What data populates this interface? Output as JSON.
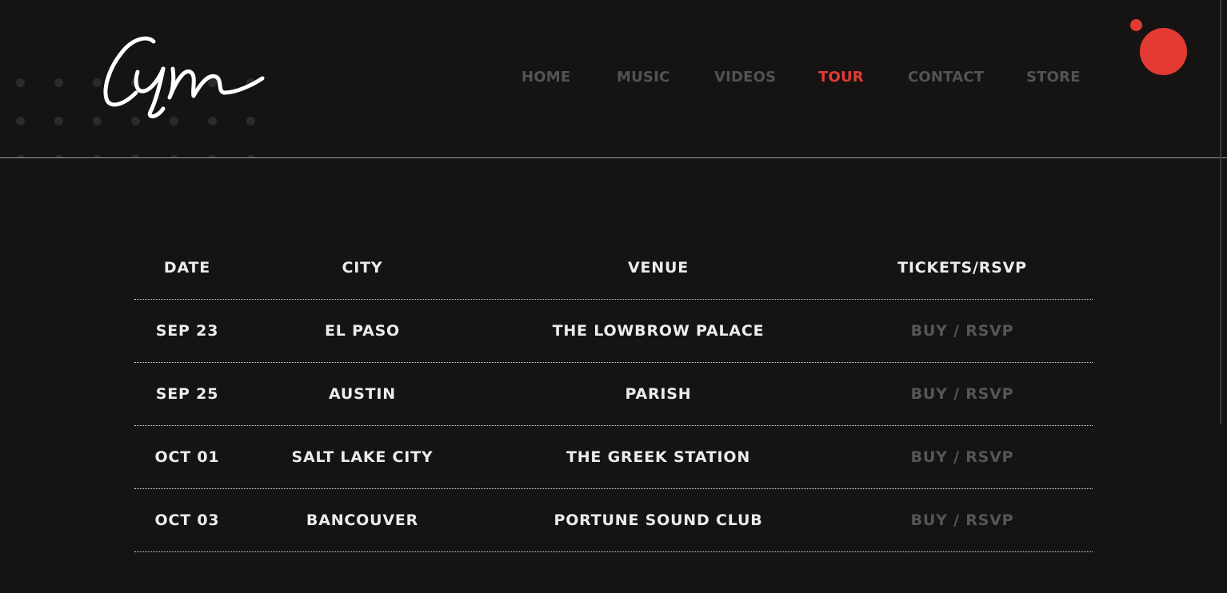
{
  "nav": {
    "items": [
      {
        "label": "HOME",
        "active": false
      },
      {
        "label": "MUSIC",
        "active": false
      },
      {
        "label": "VIDEOS",
        "active": false
      },
      {
        "label": "TOUR",
        "active": true
      },
      {
        "label": "CONTACT",
        "active": false
      },
      {
        "label": "STORE",
        "active": false
      }
    ]
  },
  "colors": {
    "background": "#151413",
    "accent": "#e33a33",
    "nav_inactive": "#555352",
    "text": "#ececea",
    "link_muted": "#585655"
  },
  "tour": {
    "headers": {
      "date": "DATE",
      "city": "CITY",
      "venue": "VENUE",
      "tickets": "TICKETS/RSVP"
    },
    "rows": [
      {
        "date": "SEP 23",
        "city": "EL PASO",
        "venue": "THE LOWBROW PALACE",
        "tickets": "BUY / RSVP"
      },
      {
        "date": "SEP 25",
        "city": "AUSTIN",
        "venue": "PARISH",
        "tickets": "BUY / RSVP"
      },
      {
        "date": "OCT 01",
        "city": "SALT LAKE CITY",
        "venue": "THE GREEK STATION",
        "tickets": "BUY / RSVP"
      },
      {
        "date": "OCT 03",
        "city": "BANCOUVER",
        "venue": "PORTUNE SOUND CLUB",
        "tickets": "BUY / RSVP"
      }
    ]
  }
}
